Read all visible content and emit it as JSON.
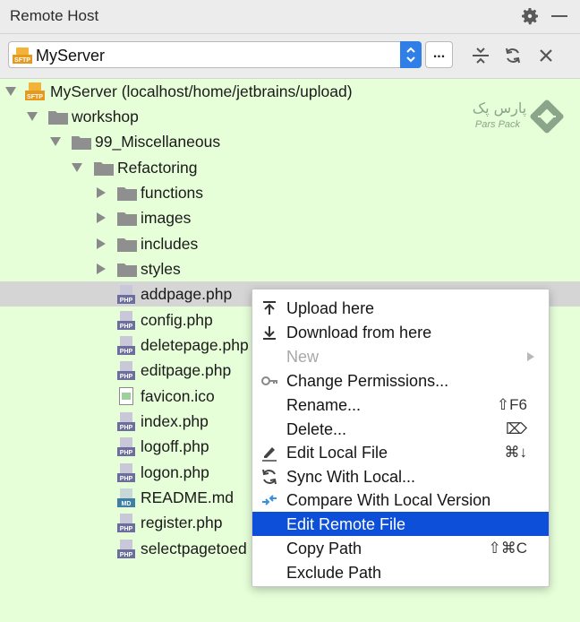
{
  "window": {
    "title": "Remote Host"
  },
  "toolbar": {
    "server_value": "MyServer",
    "more_label": "..."
  },
  "icons": {
    "gear": "gear-icon",
    "minimize": "minimize-icon",
    "collapse": "collapse-all-icon",
    "refresh": "refresh-icon",
    "close": "close-icon",
    "sftp": "sftp-server-icon"
  },
  "tree": {
    "root": "MyServer (localhost/home/jetbrains/upload)",
    "workshop": "workshop",
    "misc": "99_Miscellaneous",
    "refactoring": "Refactoring",
    "folders": [
      "functions",
      "images",
      "includes",
      "styles"
    ],
    "files": [
      {
        "name": "addpage.php",
        "icon": "php-file-icon"
      },
      {
        "name": "config.php",
        "icon": "php-file-icon"
      },
      {
        "name": "deletepage.php",
        "icon": "php-file-icon"
      },
      {
        "name": "editpage.php",
        "icon": "php-file-icon"
      },
      {
        "name": "favicon.ico",
        "icon": "image-file-icon"
      },
      {
        "name": "index.php",
        "icon": "php-file-icon"
      },
      {
        "name": "logoff.php",
        "icon": "php-file-icon"
      },
      {
        "name": "logon.php",
        "icon": "php-file-icon"
      },
      {
        "name": "README.md",
        "icon": "markdown-file-icon"
      },
      {
        "name": "register.php",
        "icon": "php-file-icon"
      },
      {
        "name": "selectpagetoed",
        "icon": "php-file-icon"
      }
    ]
  },
  "context_menu": {
    "items": [
      {
        "label": "Upload here",
        "icon": "upload-icon",
        "shortcut": ""
      },
      {
        "label": "Download from here",
        "icon": "download-icon",
        "shortcut": ""
      },
      {
        "label": "New",
        "icon": "",
        "shortcut": "",
        "disabled": true,
        "submenu": true
      },
      {
        "label": "Change Permissions...",
        "icon": "key-icon",
        "shortcut": ""
      },
      {
        "label": "Rename...",
        "icon": "",
        "shortcut": "⇧F6"
      },
      {
        "label": "Delete...",
        "icon": "",
        "shortcut": "⌦"
      },
      {
        "label": "Edit Local File",
        "icon": "pencil-icon",
        "shortcut": "⌘↓"
      },
      {
        "label": "Sync With Local...",
        "icon": "sync-icon",
        "shortcut": ""
      },
      {
        "label": "Compare With Local Version",
        "icon": "compare-icon",
        "shortcut": ""
      },
      {
        "label": "Edit Remote File",
        "icon": "",
        "shortcut": "",
        "highlighted": true
      },
      {
        "label": "Copy Path",
        "icon": "",
        "shortcut": "⇧⌘C"
      },
      {
        "label": "Exclude Path",
        "icon": "",
        "shortcut": ""
      }
    ]
  },
  "watermark": {
    "text_fa": "پارس پک",
    "text_en": "Pars Pack"
  },
  "colors": {
    "tree_bg": "#e6ffd9",
    "selection": "#0d4fd9",
    "selected_row": "#d5d5d5"
  }
}
